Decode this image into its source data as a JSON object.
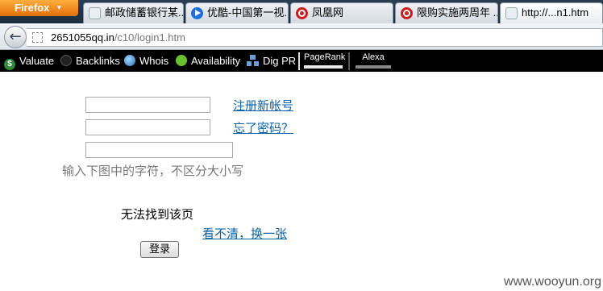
{
  "browser": {
    "menu_button": "Firefox",
    "tabs": [
      {
        "title": "邮政储蓄银行某...",
        "icon": "generic-page-icon"
      },
      {
        "title": "优酷-中国第一视...",
        "icon": "youku-icon"
      },
      {
        "title": "凤凰网",
        "icon": "ifeng-icon"
      },
      {
        "title": "限购实施两周年 ...",
        "icon": "ifeng-icon"
      },
      {
        "title": "http://...n1.htm",
        "icon": "generic-page-icon"
      }
    ],
    "url_host": "2651055qq.in",
    "url_path": "/c10/login1.htm"
  },
  "seo_toolbar": {
    "items": [
      "Valuate",
      "Backlinks",
      "Whois",
      "Availability",
      "Dig PR"
    ],
    "pagerank_label": "PageRank",
    "alexa_label": "Alexa"
  },
  "page": {
    "register_link": "注册新帐号",
    "forgot_link": "忘了密码？",
    "captcha_hint": "输入下图中的字符，不区分大小写",
    "captcha_image_alt": "无法找到该页",
    "refresh_captcha_link": "看不清，换一张",
    "login_button": "登录"
  },
  "watermark": "www.wooyun.org"
}
